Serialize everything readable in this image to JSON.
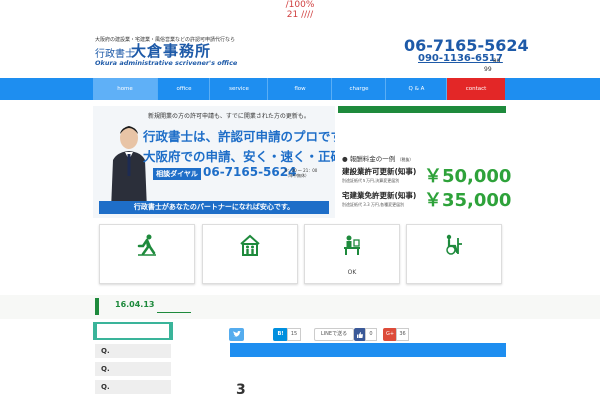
{
  "notice": {
    "line1": "/100%",
    "line2": "21     ////"
  },
  "header": {
    "tagline": "大阪府の建設業・宅建業・風俗営業などの許認可申請代行なら",
    "logo_small": "行政書士",
    "logo_big": "大倉事務所",
    "logo_en": "Okura administrative scrivener's office",
    "phone1": "06-7165-5624",
    "phone2": "090-1136-6517",
    "phone2_suffix": "au",
    "phone_note": "99"
  },
  "nav": {
    "items": [
      {
        "label": "home"
      },
      {
        "label": "office"
      },
      {
        "label": "service"
      },
      {
        "label": "flow"
      },
      {
        "label": "charge"
      },
      {
        "label": "Q & A"
      },
      {
        "label": "contact"
      }
    ]
  },
  "hero": {
    "text1": "新規開業の方の許可申請も、すでに開業された方の更新も。",
    "text2": "行政書士は、許認可申請のプロです。",
    "text3": "大阪府での申請、安く・速く・正確に。",
    "dial_label": "相談ダイヤル",
    "dial_number": "06-7165-5624",
    "dial_hours": "9：00 〜 21：00",
    "dial_hours_note": "（年中無休）",
    "bottom_bar": "行政書士があなたのパートナーになれば安心です。"
  },
  "fees": {
    "title": "● 報酬料金の一例",
    "title_note": "（税抜）",
    "items": [
      {
        "label": "建設業許可更新(知事)",
        "sub": "別途証紙代５万円,決算変更届別",
        "price": "￥50,000"
      },
      {
        "label": "宅建業免許更新(知事)",
        "sub": "別途証紙代 3.3 万円,各種変更届別",
        "price": "￥35,000"
      }
    ]
  },
  "cards": [
    {
      "icon": "running-person-icon",
      "label": ""
    },
    {
      "icon": "house-family-icon",
      "label": ""
    },
    {
      "icon": "office-worker-icon",
      "label": "OK"
    },
    {
      "icon": "wheelchair-icon",
      "label": ""
    }
  ],
  "date": {
    "text": "16.04.13"
  },
  "sidebar": {
    "items": [
      {
        "label": "Q."
      },
      {
        "label": "Q."
      },
      {
        "label": "Q."
      }
    ]
  },
  "social": {
    "twitter": "tweet",
    "hatena": "B!",
    "hatena_count": "15",
    "line": "LINEで送る",
    "fb_count": "0",
    "gplus": "G+",
    "gplus_count": "36"
  },
  "colors": {
    "nav_blue": "#1e8ef0",
    "contact_red": "#e32727",
    "accent_green": "#1e8a3c",
    "logo_blue": "#1e5aa8"
  },
  "article": {
    "number": "3"
  }
}
